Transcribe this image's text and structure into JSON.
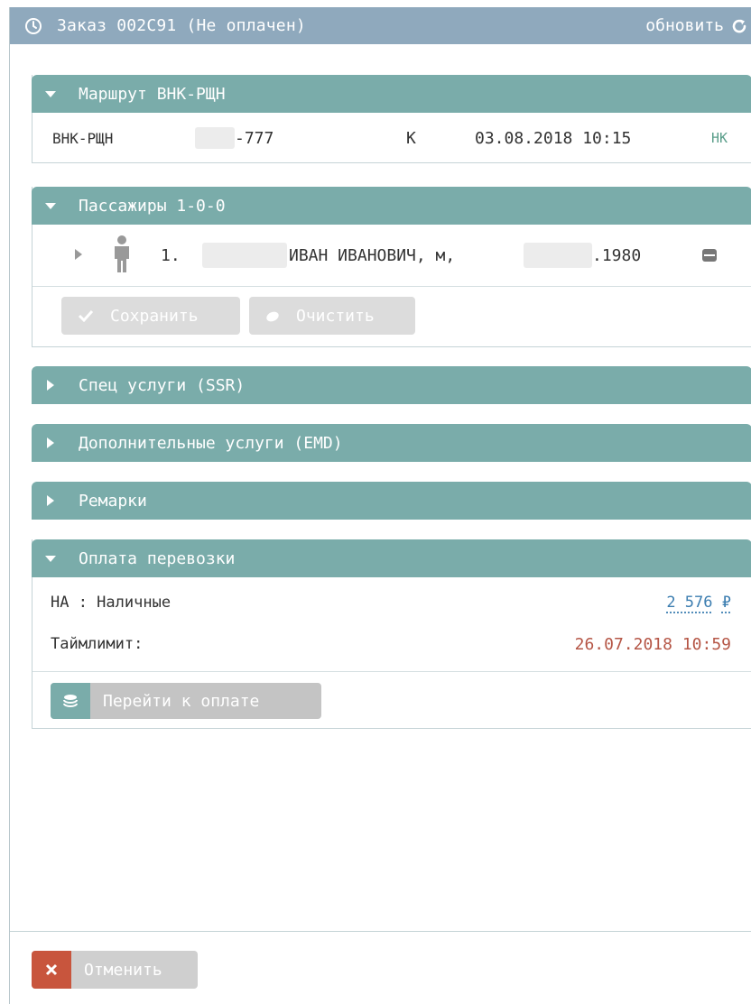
{
  "titlebar": {
    "title": "Заказ 002С91 (Не оплачен)",
    "refresh_label": "обновить"
  },
  "route_panel": {
    "header": "Маршрут ВНК-РЩН",
    "segment": {
      "route": "ВНК-РЩН",
      "flight_suffix": "-777",
      "class": "К",
      "datetime": "03.08.2018 10:15",
      "status": "HK"
    }
  },
  "passengers_panel": {
    "header": "Пассажиры 1-0-0",
    "passenger": {
      "index": "1.",
      "name": "ИВАН ИВАНОВИЧ, м,",
      "birth_year_suffix": ".1980"
    },
    "save_label": "Сохранить",
    "clear_label": "Очистить"
  },
  "ssr_panel": {
    "header": "Спец услуги (SSR)"
  },
  "emd_panel": {
    "header": "Дополнительные услуги (EMD)"
  },
  "remarks_panel": {
    "header": "Ремарки"
  },
  "payment_panel": {
    "header": "Оплата перевозки",
    "method_label": "НА : Наличные",
    "amount": "2 576",
    "currency": "₽",
    "timelimit_label": "Таймлимит:",
    "timelimit_value": "26.07.2018 10:59",
    "pay_label": "Перейти к оплате"
  },
  "footer": {
    "cancel_label": "Отменить"
  },
  "colors": {
    "titlebar": "#8fa9bd",
    "panel_header": "#7aacaa",
    "timelimit": "#b55646",
    "cancel": "#c8553d",
    "link": "#3b7db0"
  }
}
